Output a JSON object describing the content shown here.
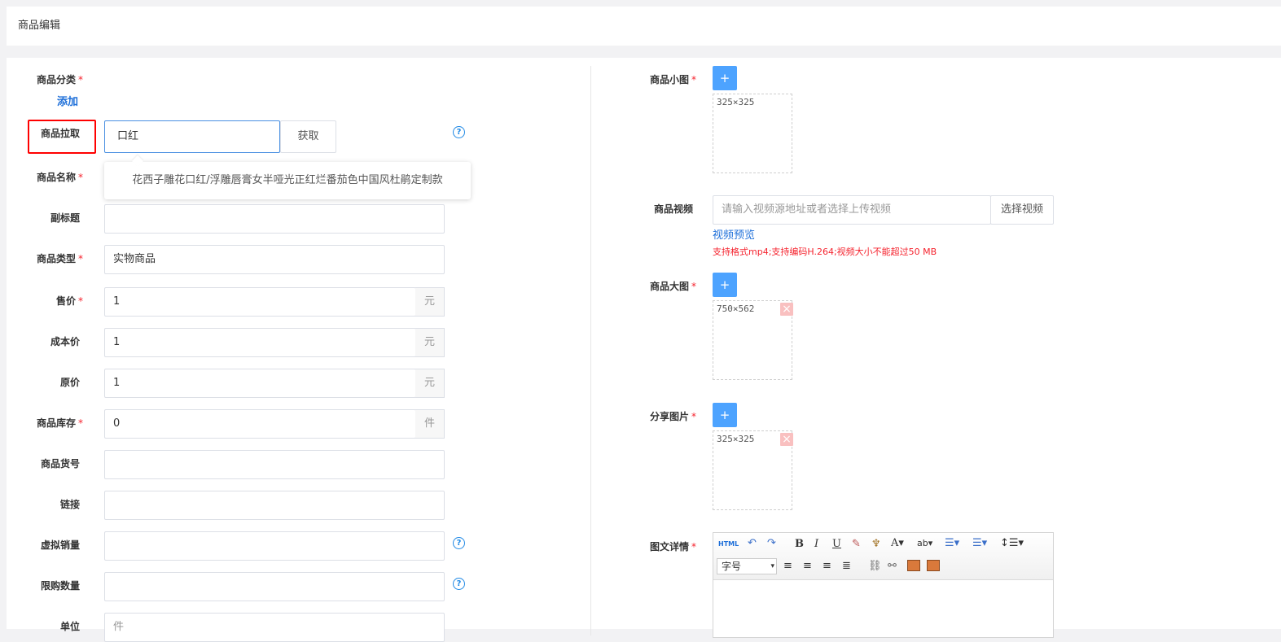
{
  "header": {
    "title": "商品编辑"
  },
  "left": {
    "category": {
      "label": "商品分类",
      "add_link": "添加"
    },
    "pull": {
      "label": "商品拉取",
      "value": "口红",
      "button": "获取",
      "suggestion": "花西子雕花口红/浮雕唇膏女半哑光正红烂番茄色中国风杜鹃定制款"
    },
    "name": {
      "label": "商品名称"
    },
    "subtitle": {
      "label": "副标题",
      "value": ""
    },
    "type": {
      "label": "商品类型",
      "value": "实物商品"
    },
    "price": {
      "label": "售价",
      "value": "1",
      "unit": "元"
    },
    "cost": {
      "label": "成本价",
      "value": "1",
      "unit": "元"
    },
    "original": {
      "label": "原价",
      "value": "1",
      "unit": "元"
    },
    "stock": {
      "label": "商品库存",
      "value": "0",
      "unit": "件"
    },
    "sku": {
      "label": "商品货号",
      "value": ""
    },
    "link": {
      "label": "链接",
      "value": ""
    },
    "virtual_sales": {
      "label": "虚拟销量",
      "value": ""
    },
    "limit": {
      "label": "限购数量",
      "value": ""
    },
    "unit": {
      "label": "单位",
      "value": "件"
    },
    "required_mark": "*",
    "help_mark": "?"
  },
  "right": {
    "thumb": {
      "label": "商品小图",
      "size": "325×325"
    },
    "video": {
      "label": "商品视频",
      "placeholder": "请输入视频源地址或者选择上传视频",
      "button": "选择视频",
      "preview": "视频预览",
      "hint": "支持格式mp4;支持编码H.264;视频大小不能超过50 MB"
    },
    "large": {
      "label": "商品大图",
      "size": "750×562"
    },
    "share": {
      "label": "分享图片",
      "size": "325×325"
    },
    "detail": {
      "label": "图文详情"
    },
    "plus": "+",
    "delete": "×"
  },
  "editor": {
    "html": "HTML",
    "font_size": "字号"
  },
  "colors": {
    "accent": "#4da3ff",
    "link": "#1e6fd9",
    "required": "#f5222d",
    "highlight_box": "#ff0000"
  }
}
